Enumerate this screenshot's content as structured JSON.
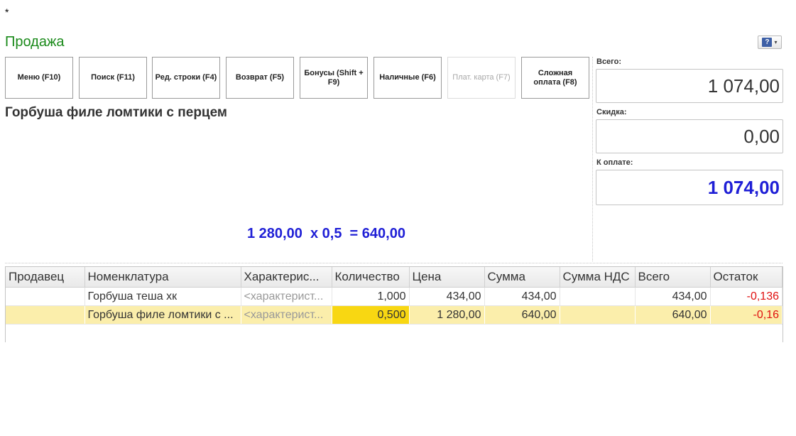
{
  "window": {
    "modified_marker": "*"
  },
  "header": {
    "title": "Продажа"
  },
  "toolbar": {
    "buttons": [
      {
        "label": "Меню (F10)",
        "enabled": true
      },
      {
        "label": "Поиск (F11)",
        "enabled": true
      },
      {
        "label": "Ред. строки (F4)",
        "enabled": true
      },
      {
        "label": "Возврат (F5)",
        "enabled": true
      },
      {
        "label": "Бонусы (Shift + F9)",
        "enabled": true
      },
      {
        "label": "Наличные (F6)",
        "enabled": true
      },
      {
        "label": "Плат. карта (F7)",
        "enabled": false
      },
      {
        "label": "Сложная оплата (F8)",
        "enabled": true
      }
    ],
    "help_icon": "help-icon"
  },
  "current_item": {
    "name": "Горбуша филе ломтики с перцем",
    "calculation": "1 280,00  x 0,5  = 640,00"
  },
  "totals": {
    "total_label": "Всего:",
    "total_value": "1 074,00",
    "discount_label": "Скидка:",
    "discount_value": "0,00",
    "to_pay_label": "К оплате:",
    "to_pay_value": "1 074,00"
  },
  "table": {
    "columns": [
      "Продавец",
      "Номенклатура",
      "Характерис...",
      "Количество",
      "Цена",
      "Сумма",
      "Сумма НДС",
      "Всего",
      "Остаток"
    ],
    "rows": [
      {
        "seller": "",
        "item": "Горбуша теша хк",
        "characteristic": "<характерист...",
        "quantity": "1,000",
        "price": "434,00",
        "sum": "434,00",
        "vat": "",
        "total": "434,00",
        "stock": "-0,136"
      },
      {
        "seller": "",
        "item": "Горбуша филе ломтики с ...",
        "characteristic": "<характерист...",
        "quantity": "0,500",
        "price": "1 280,00",
        "sum": "640,00",
        "vat": "",
        "total": "640,00",
        "stock": "-0,16"
      }
    ],
    "selected_row": 1
  },
  "colors": {
    "title": "#1a8a1a",
    "accent_blue": "#1f1fd6",
    "negative": "#e01010",
    "selected_row": "#fbeeab",
    "active_cell": "#f8d712"
  }
}
